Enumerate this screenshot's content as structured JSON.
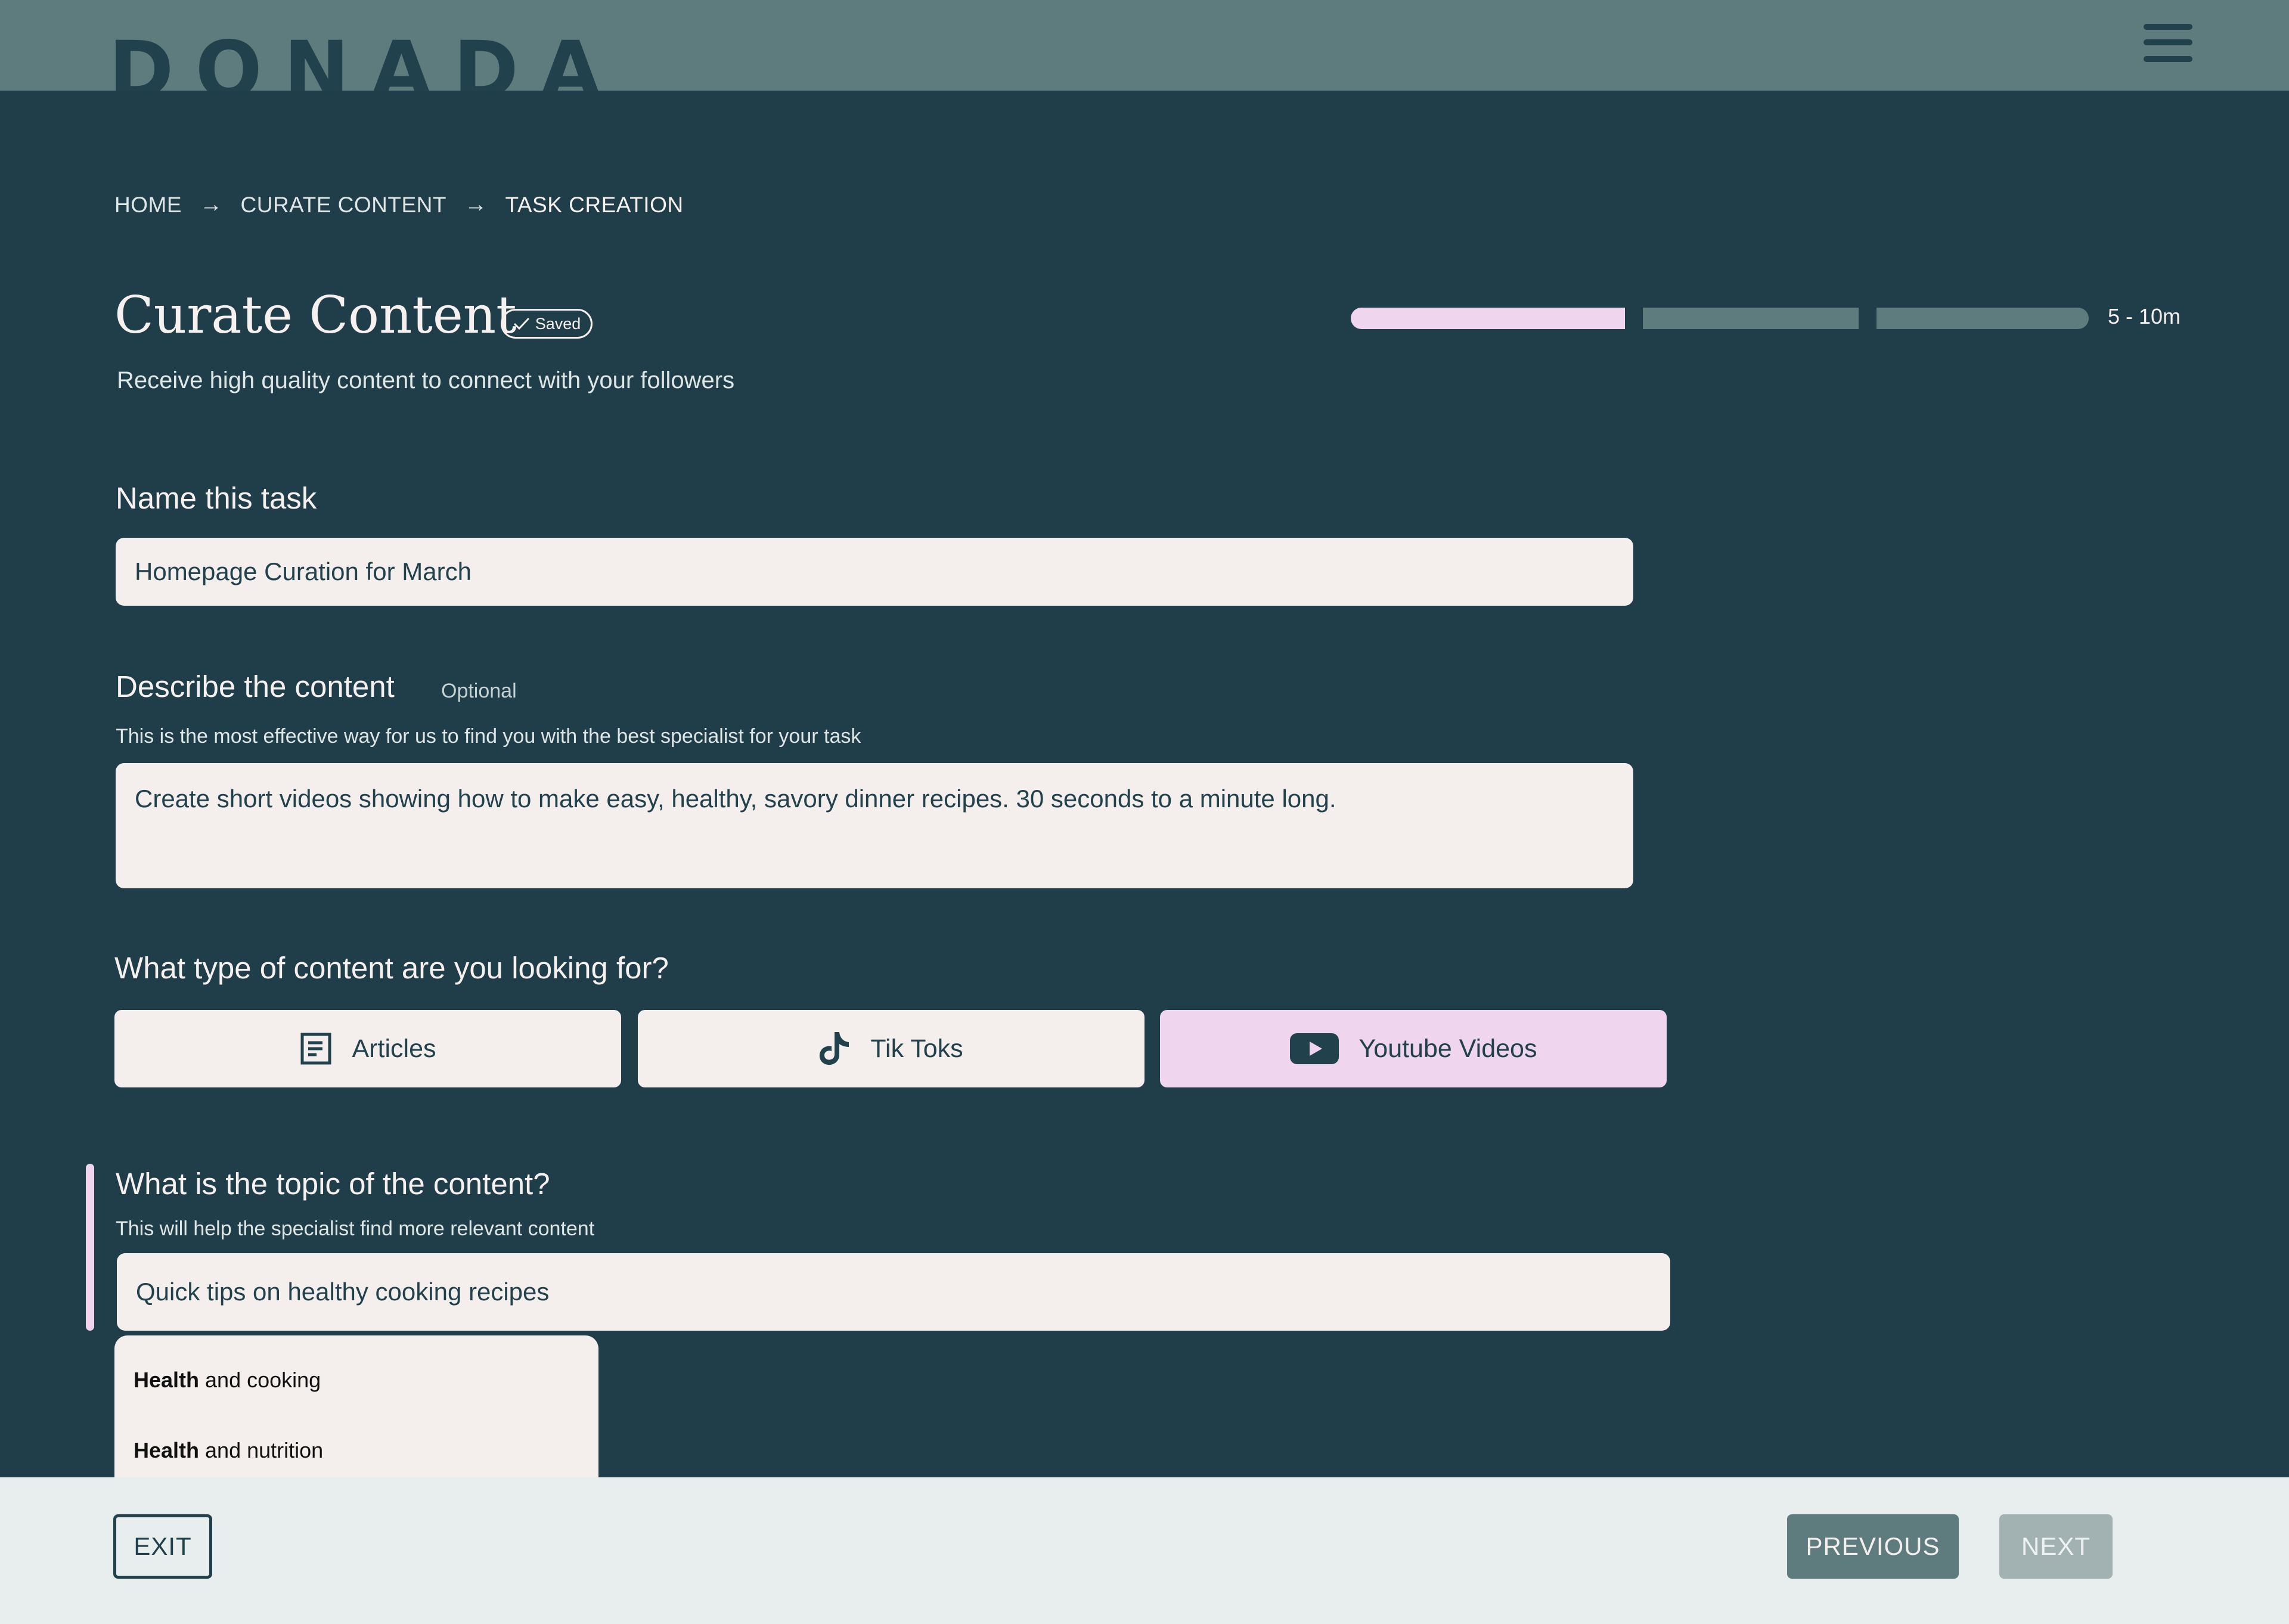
{
  "header": {
    "logo": "DONADA",
    "menu_icon": "hamburger-menu-icon"
  },
  "breadcrumb": {
    "items": [
      "HOME",
      "CURATE CONTENT",
      "TASK CREATION"
    ],
    "separator": "→"
  },
  "page": {
    "title": "Curate Content",
    "saved_label": "Saved",
    "subtitle": "Receive high quality content to connect with your followers"
  },
  "progress": {
    "steps_total": 3,
    "steps_completed": 1,
    "duration": "5 - 10m",
    "active_color": "#efd6ee",
    "inactive_color": "#5e7b7e"
  },
  "task_name": {
    "label": "Name this task",
    "value": "Homepage Curation for March"
  },
  "description": {
    "label": "Describe the content",
    "optional_label": "Optional",
    "help": "This is the most effective way for us to find you with the best specialist for your task",
    "value": "Create short videos showing how to make easy, healthy, savory dinner recipes. 30 seconds to a minute long."
  },
  "content_type": {
    "label": "What type of content are you looking for?",
    "options": [
      {
        "label": "Articles",
        "icon": "article-icon",
        "selected": false
      },
      {
        "label": "Tik Toks",
        "icon": "tiktok-icon",
        "selected": false
      },
      {
        "label": "Youtube Videos",
        "icon": "youtube-icon",
        "selected": true
      }
    ]
  },
  "topic": {
    "label": "What is the topic of the content?",
    "help": "This will help the specialist find more relevant content",
    "value": "Quick tips on healthy cooking recipes",
    "suggestions": [
      {
        "bold": "Health",
        "rest": " and cooking"
      },
      {
        "bold": "Health",
        "rest": " and nutrition"
      }
    ]
  },
  "footer": {
    "exit_label": "EXIT",
    "previous_label": "PREVIOUS",
    "next_label": "NEXT"
  },
  "colors": {
    "background": "#203d4a",
    "header": "#5e7b7e",
    "accent": "#efd6ee",
    "field": "#f4efec",
    "footer": "#e8eeee"
  }
}
